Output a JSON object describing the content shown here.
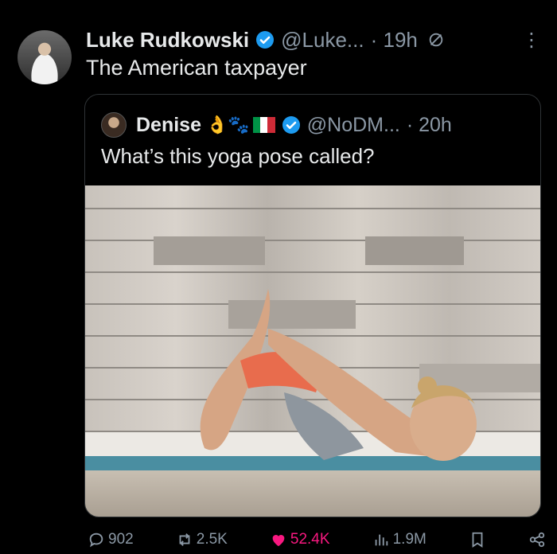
{
  "tweet": {
    "author_name": "Luke Rudkowski",
    "author_handle": "@Luke...",
    "time": "· 19h",
    "text": "The American taxpayer"
  },
  "quoted": {
    "author_name": "Denise",
    "emojis": "👌🐾",
    "author_handle": "@NoDM...",
    "time": "· 20h",
    "text": "What’s this yoga pose called?"
  },
  "actions": {
    "replies": "902",
    "reposts": "2.5K",
    "likes": "52.4K",
    "views": "1.9M"
  },
  "colors": {
    "background": "#000000",
    "verified": "#1d9bf0",
    "like": "#f91880",
    "muted": "#8b98a5"
  }
}
